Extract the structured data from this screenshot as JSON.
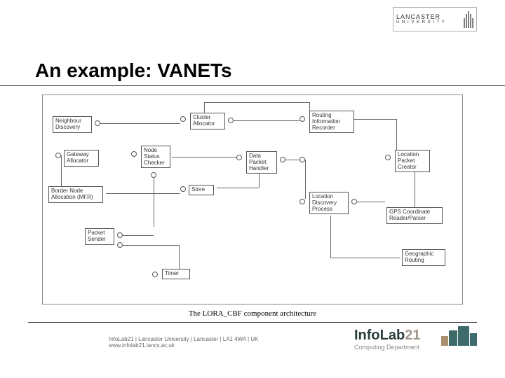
{
  "header": {
    "university": "LANCASTER",
    "university_sub": "U N I V E R S I T Y"
  },
  "title": "An example: VANETs",
  "caption": "The LORA_CBF component architecture",
  "components": {
    "neighbour_discovery": "Neighbour Discovery",
    "gateway_allocator": "Gateway Allocator",
    "border_node": "Border Node Allocation (MFR)",
    "packet_sender": "Packet Sender",
    "node_status": "Node Status Checker",
    "cluster_allocator": "Cluster Allocator",
    "store": "Store",
    "timer": "Timer",
    "data_packet": "Data Packet Handler",
    "routing_info": "Routing Information Recorder",
    "location_discovery": "Location Discovery Process",
    "location_packet": "Location Packet Creator",
    "gps": "GPS Coordinate Reader/Parser",
    "geographic_routing": "Geographic Routing"
  },
  "footer": {
    "address": "InfoLab21 | Lancaster University | Lancaster | LA1 4WA | UK",
    "url": "www.infolab21.lancs.ac.uk",
    "brand": "InfoLab",
    "brand_num": "21",
    "dept": "Computing Department"
  }
}
